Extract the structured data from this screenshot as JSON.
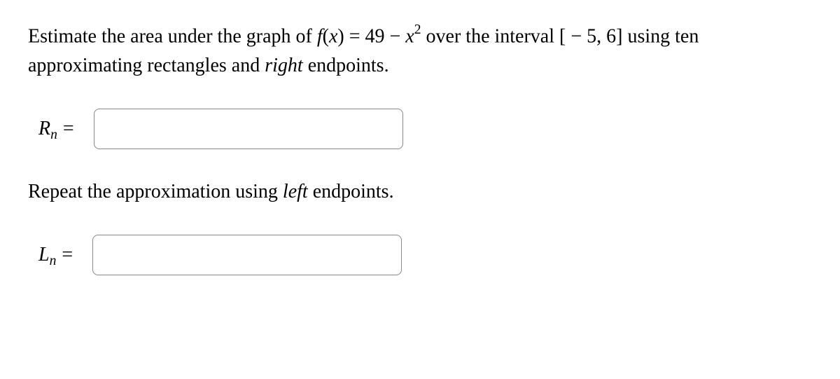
{
  "question": {
    "part1": "Estimate the area under the graph of ",
    "func_f": "f",
    "func_open": "(",
    "func_var": "x",
    "func_close": ")",
    "eq": " = ",
    "const1": "49",
    "minus": " − ",
    "var2": "x",
    "exp2": "2",
    "part2": " over the interval ",
    "interval_open": "[",
    "interval_neg": " − ",
    "interval_a": "5",
    "interval_comma": ", ",
    "interval_b": "6",
    "interval_close": "]",
    "part3": " using ten approximating rectangles and ",
    "right_word": "right",
    "part4": " endpoints."
  },
  "rn": {
    "letter": "R",
    "sub": "n",
    "equals": "=",
    "value": ""
  },
  "followup": {
    "part1": "Repeat the approximation using ",
    "left_word": "left",
    "part2": " endpoints."
  },
  "ln": {
    "letter": "L",
    "sub": "n",
    "equals": "=",
    "value": ""
  }
}
